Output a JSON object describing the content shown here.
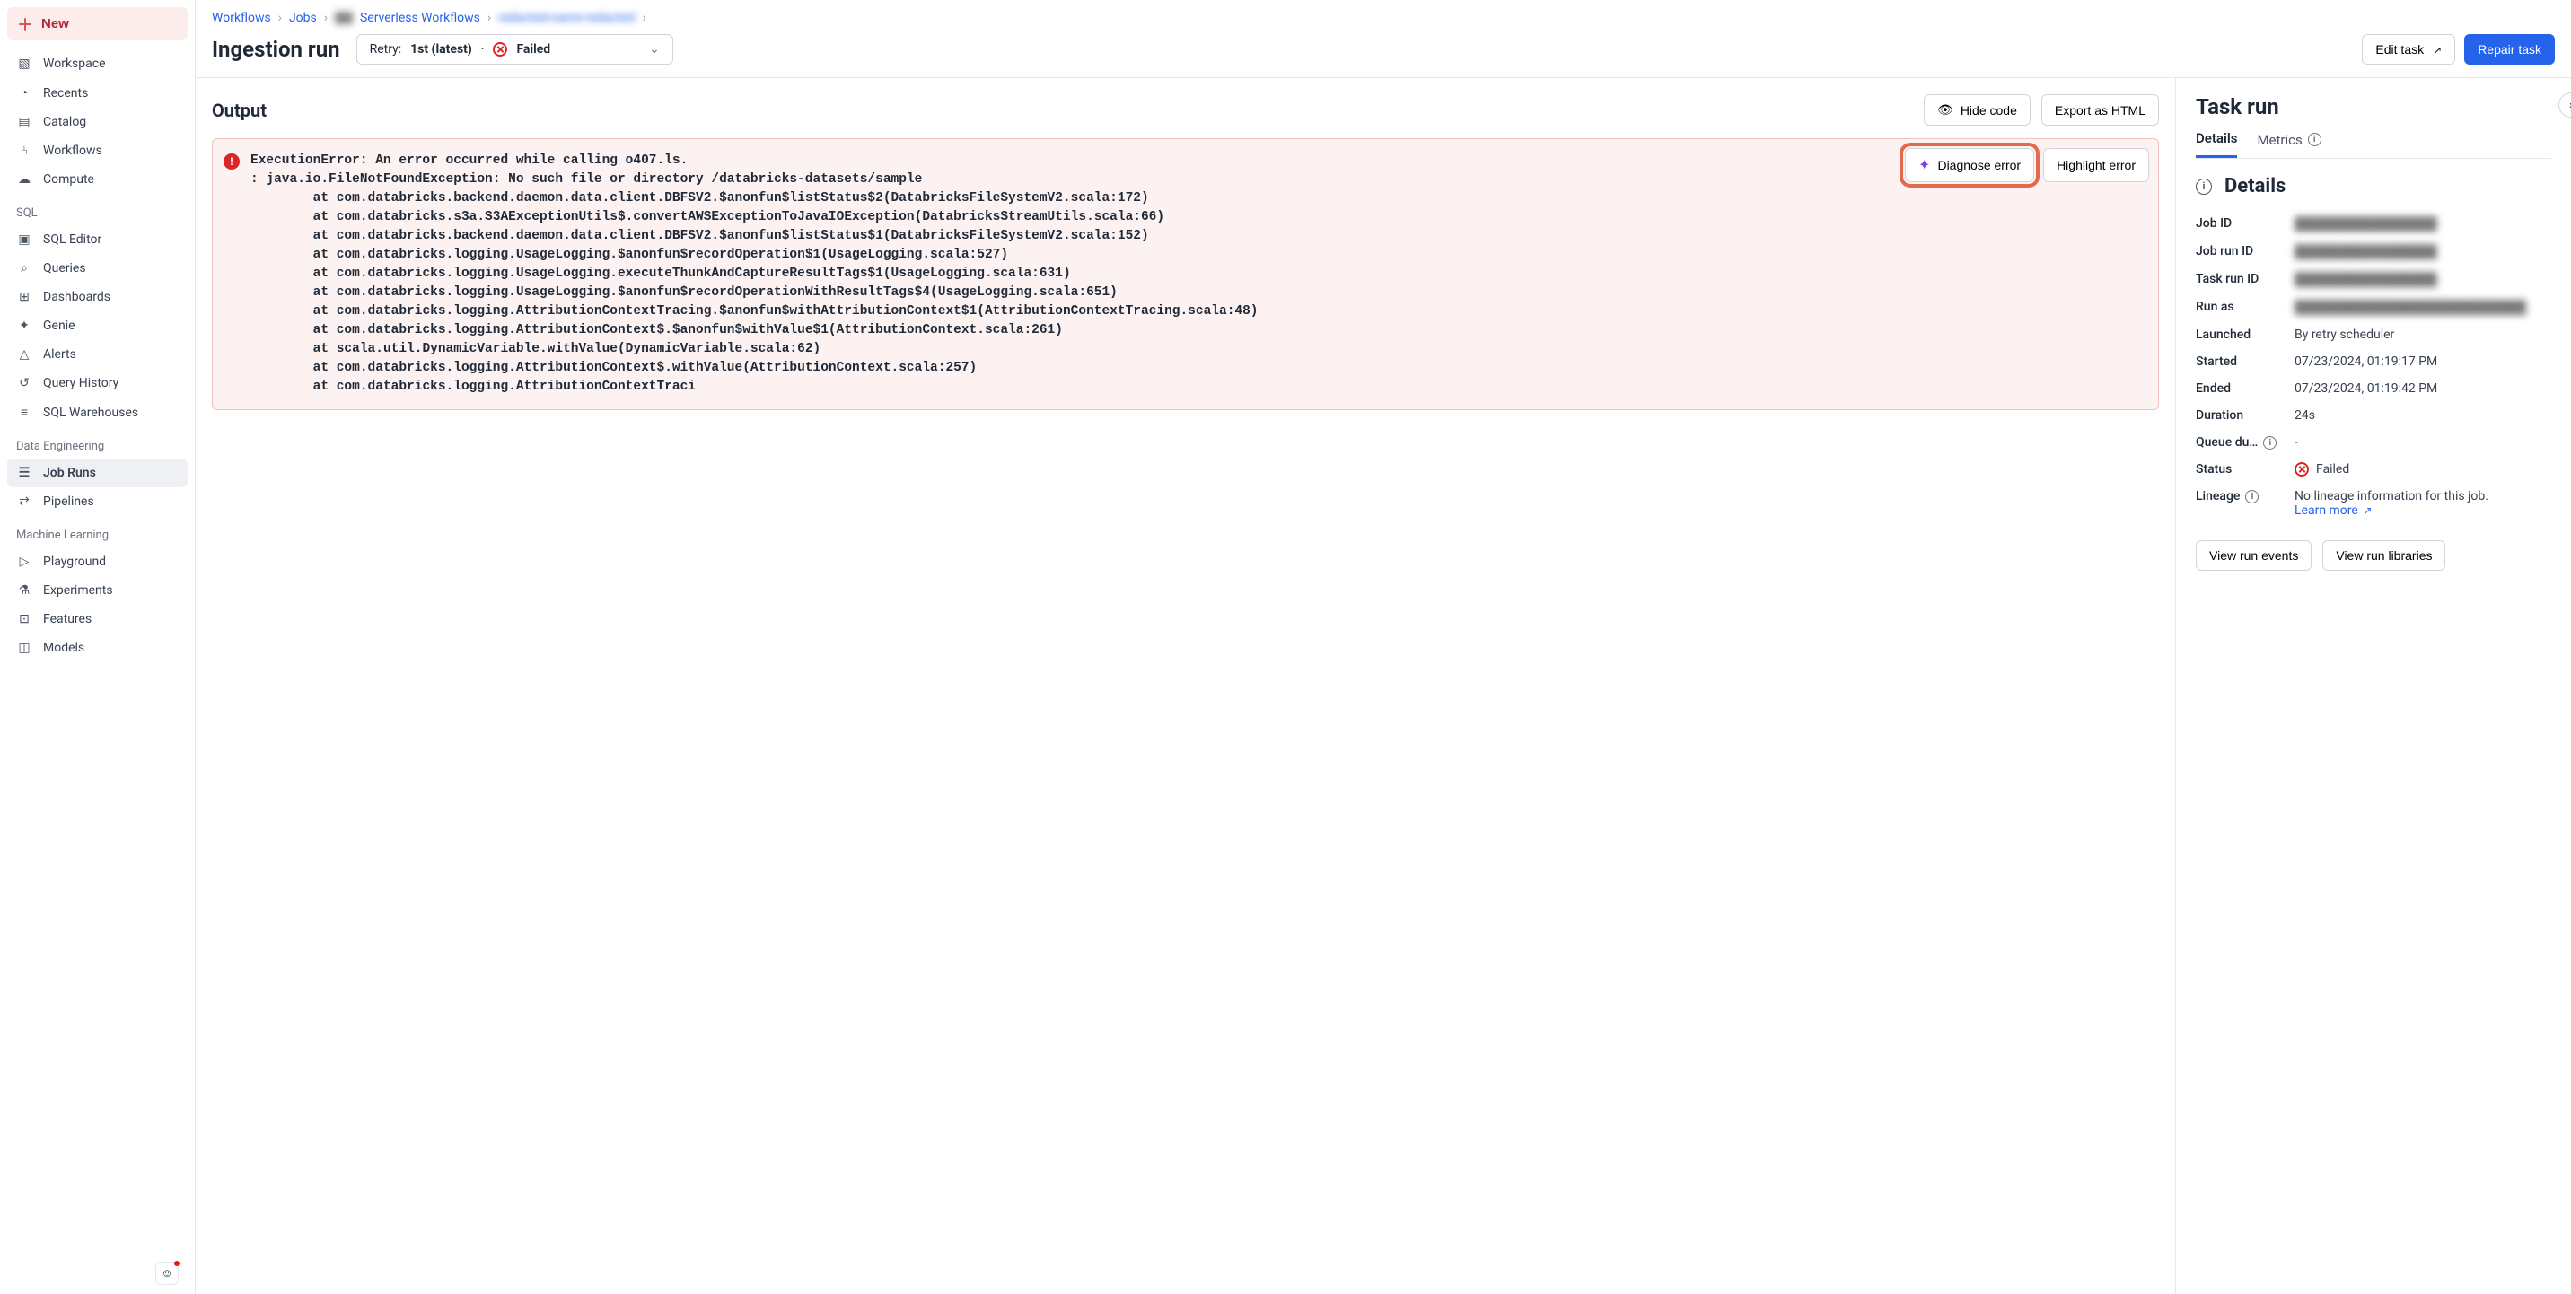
{
  "sidebar": {
    "newLabel": "New",
    "primary": [
      {
        "id": "workspace",
        "label": "Workspace"
      },
      {
        "id": "recents",
        "label": "Recents"
      },
      {
        "id": "catalog",
        "label": "Catalog"
      },
      {
        "id": "workflows",
        "label": "Workflows"
      },
      {
        "id": "compute",
        "label": "Compute"
      }
    ],
    "sqlTitle": "SQL",
    "sql": [
      {
        "id": "sql-editor",
        "label": "SQL Editor"
      },
      {
        "id": "queries",
        "label": "Queries"
      },
      {
        "id": "dashboards",
        "label": "Dashboards"
      },
      {
        "id": "genie",
        "label": "Genie"
      },
      {
        "id": "alerts",
        "label": "Alerts"
      },
      {
        "id": "query-history",
        "label": "Query History"
      },
      {
        "id": "sql-warehouses",
        "label": "SQL Warehouses"
      }
    ],
    "deTitle": "Data Engineering",
    "de": [
      {
        "id": "job-runs",
        "label": "Job Runs",
        "active": true
      },
      {
        "id": "pipelines",
        "label": "Pipelines"
      }
    ],
    "mlTitle": "Machine Learning",
    "ml": [
      {
        "id": "playground",
        "label": "Playground"
      },
      {
        "id": "experiments",
        "label": "Experiments"
      },
      {
        "id": "features",
        "label": "Features"
      },
      {
        "id": "models",
        "label": "Models"
      }
    ]
  },
  "breadcrumb": {
    "items": [
      "Workflows",
      "Jobs",
      "Serverless Workflows",
      ""
    ],
    "blurred3": "redacted-name-redacted"
  },
  "pageTitle": "Ingestion run",
  "retry": {
    "prefix": "Retry:",
    "value": "1st (latest)",
    "sep": " · ",
    "status": "Failed"
  },
  "topButtons": {
    "edit": "Edit task",
    "repair": "Repair task"
  },
  "output": {
    "title": "Output",
    "hideCode": "Hide code",
    "exportHtml": "Export as HTML",
    "diagnose": "Diagnose error",
    "highlight": "Highlight error",
    "errorText": "ExecutionError: An error occurred while calling o407.ls.\n: java.io.FileNotFoundException: No such file or directory /databricks-datasets/sample\n        at com.databricks.backend.daemon.data.client.DBFSV2.$anonfun$listStatus$2(DatabricksFileSystemV2.scala:172)\n        at com.databricks.s3a.S3AExceptionUtils$.convertAWSExceptionToJavaIOException(DatabricksStreamUtils.scala:66)\n        at com.databricks.backend.daemon.data.client.DBFSV2.$anonfun$listStatus$1(DatabricksFileSystemV2.scala:152)\n        at com.databricks.logging.UsageLogging.$anonfun$recordOperation$1(UsageLogging.scala:527)\n        at com.databricks.logging.UsageLogging.executeThunkAndCaptureResultTags$1(UsageLogging.scala:631)\n        at com.databricks.logging.UsageLogging.$anonfun$recordOperationWithResultTags$4(UsageLogging.scala:651)\n        at com.databricks.logging.AttributionContextTracing.$anonfun$withAttributionContext$1(AttributionContextTracing.scala:48)\n        at com.databricks.logging.AttributionContext$.$anonfun$withValue$1(AttributionContext.scala:261)\n        at scala.util.DynamicVariable.withValue(DynamicVariable.scala:62)\n        at com.databricks.logging.AttributionContext$.withValue(AttributionContext.scala:257)\n        at com.databricks.logging.AttributionContextTraci"
  },
  "taskRun": {
    "title": "Task run",
    "tabs": {
      "details": "Details",
      "metrics": "Metrics"
    },
    "detailsHeading": "Details",
    "rows": {
      "jobId": {
        "k": "Job ID",
        "v": "████████████████"
      },
      "jobRunId": {
        "k": "Job run ID",
        "v": "████████████████"
      },
      "taskRunId": {
        "k": "Task run ID",
        "v": "████████████████"
      },
      "runAs": {
        "k": "Run as",
        "v": "██████████████████████████"
      },
      "launched": {
        "k": "Launched",
        "v": "By retry scheduler"
      },
      "started": {
        "k": "Started",
        "v": "07/23/2024, 01:19:17 PM"
      },
      "ended": {
        "k": "Ended",
        "v": "07/23/2024, 01:19:42 PM"
      },
      "duration": {
        "k": "Duration",
        "v": "24s"
      },
      "queue": {
        "k": "Queue du…",
        "v": "-"
      },
      "status": {
        "k": "Status",
        "v": "Failed"
      },
      "lineage": {
        "k": "Lineage",
        "v": "No lineage information for this job.",
        "learn": "Learn more"
      }
    },
    "buttons": {
      "events": "View run events",
      "libs": "View run libraries"
    }
  }
}
